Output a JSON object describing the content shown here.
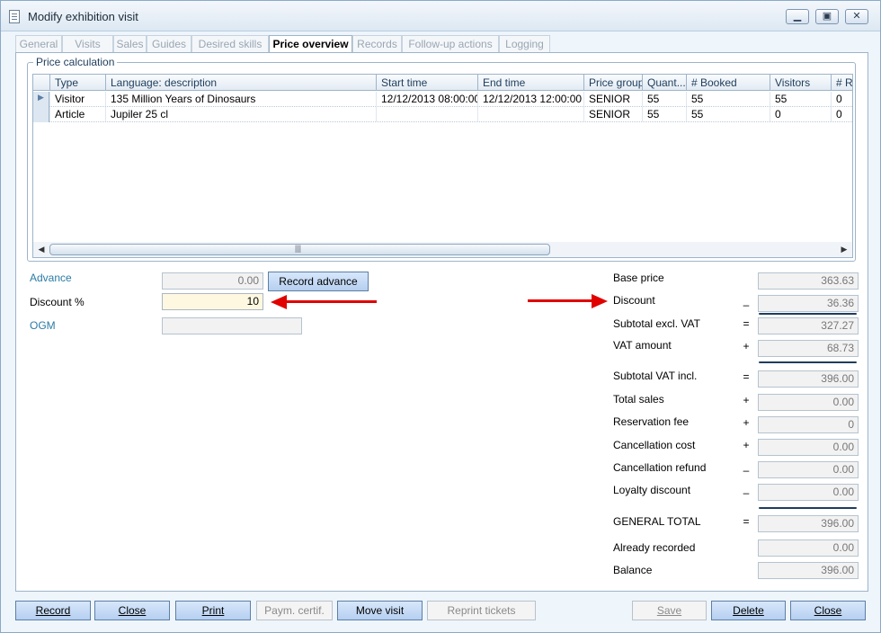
{
  "window": {
    "title": "Modify exhibition visit"
  },
  "tabs": [
    "General",
    "Visits",
    "Sales",
    "Guides",
    "Desired skills",
    "Price overview",
    "Records",
    "Follow-up actions",
    "Logging"
  ],
  "active_tab": "Price overview",
  "price_calc": {
    "group_label": "Price calculation",
    "columns": [
      "Type",
      "Language: description",
      "Start time",
      "End time",
      "Price group",
      "Quant...",
      "# Booked",
      "Visitors",
      "# R"
    ],
    "rows": [
      [
        "Visitor",
        "135 Million Years of Dinosaurs",
        "12/12/2013 08:00:00",
        "12/12/2013 12:00:00",
        "SENIOR",
        "55",
        "55",
        "55",
        "0"
      ],
      [
        "Article",
        "Jupiler 25 cl",
        "",
        "",
        "SENIOR",
        "55",
        "55",
        "0",
        "0"
      ]
    ]
  },
  "left": {
    "advance_label": "Advance",
    "advance_value": "0.00",
    "record_advance_label": "Record advance",
    "discount_label": "Discount %",
    "discount_value": "10",
    "ogm_label": "OGM",
    "ogm_value": ""
  },
  "totals": [
    {
      "label": "Base price",
      "op": "",
      "value": "363.63"
    },
    {
      "label": "Discount",
      "op": "–",
      "value": "36.36"
    },
    {
      "label": "Subtotal excl. VAT",
      "op": "=",
      "value": "327.27"
    },
    {
      "label": "VAT amount",
      "op": "+",
      "value": "68.73"
    },
    {
      "label": "Subtotal VAT incl.",
      "op": "=",
      "value": "396.00"
    },
    {
      "label": "Total sales",
      "op": "+",
      "value": "0.00"
    },
    {
      "label": "Reservation fee",
      "op": "+",
      "value": "0"
    },
    {
      "label": "Cancellation cost",
      "op": "+",
      "value": "0.00"
    },
    {
      "label": "Cancellation refund",
      "op": "–",
      "value": "0.00"
    },
    {
      "label": "Loyalty discount",
      "op": "–",
      "value": "0.00"
    },
    {
      "label": "GENERAL TOTAL",
      "op": "=",
      "value": "396.00"
    },
    {
      "label": "Already recorded",
      "op": "",
      "value": "0.00"
    },
    {
      "label": "Balance",
      "op": "",
      "value": "396.00"
    }
  ],
  "buttons": {
    "record": "Record",
    "close1": "Close",
    "print": "Print",
    "paym_certif": "Paym. certif.",
    "move_visit": "Move visit",
    "reprint": "Reprint tickets",
    "save": "Save",
    "delete": "Delete",
    "close2": "Close"
  },
  "colors": {
    "accent": "#2a7ca6",
    "arrow": "#e00000",
    "button": "#c6dbf5"
  }
}
